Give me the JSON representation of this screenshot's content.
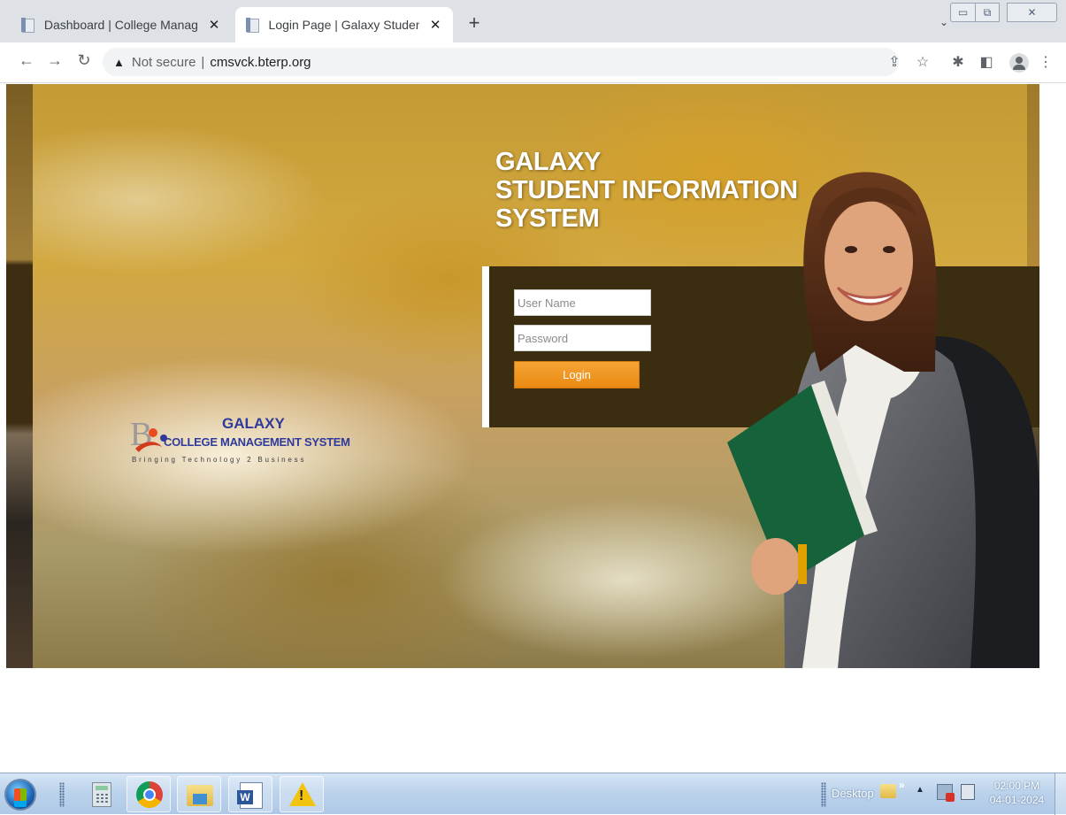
{
  "browser": {
    "tabs": [
      {
        "title": "Dashboard | College Management System",
        "active": false
      },
      {
        "title": "Login Page | Galaxy Student Information System",
        "active": true
      }
    ],
    "address": {
      "security_label": "Not secure",
      "separator": "|",
      "url": "cmsvck.bterp.org"
    }
  },
  "page": {
    "heading_lines": [
      "GALAXY",
      "STUDENT INFORMATION",
      "SYSTEM"
    ],
    "login": {
      "username_placeholder": "User Name",
      "password_placeholder": "Password",
      "button_label": "Login"
    },
    "logo": {
      "name_line1": "GALAXY",
      "name_line2": "COLLEGE MANAGEMENT SYSTEM",
      "tagline": "Bringing Technology 2 Business"
    }
  },
  "taskbar": {
    "apps": [
      "calculator-icon",
      "chrome-icon",
      "file-manager-icon",
      "word-icon",
      "warning-icon"
    ],
    "tray": {
      "desktop_label": "Desktop",
      "time": "02:00 PM",
      "date": "04-01-2024"
    }
  },
  "colors": {
    "panel": "#3b2e10",
    "login_button": "#ea8a12",
    "logo_blue": "#2f3a9a"
  }
}
